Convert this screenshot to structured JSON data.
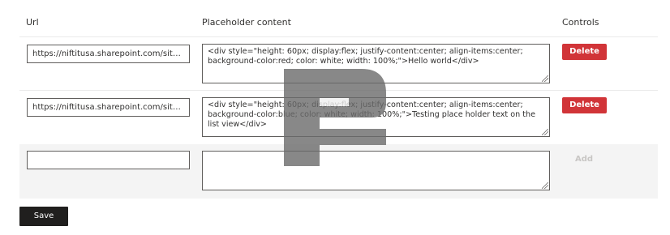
{
  "headers": {
    "url": "Url",
    "placeholder": "Placeholder content",
    "controls": "Controls"
  },
  "rows": [
    {
      "url": "https://niftitusa.sharepoint.com/sites/...",
      "placeholder": "<div style=\"height: 60px; display:flex; justify-content:center; align-items:center; background-color:red; color: white; width: 100%;\">Hello world</div>",
      "delete_label": "Delete"
    },
    {
      "url": "https://niftitusa.sharepoint.com/sites/...",
      "placeholder": "<div style=\"height: 60px; display:flex; justify-content:center; align-items:center; background-color:blue; color: white; width: 100%;\">Testing place holder text on the list view</div>",
      "delete_label": "Delete"
    }
  ],
  "new_row": {
    "url": "",
    "placeholder": "",
    "add_label": "Add"
  },
  "save_label": "Save",
  "colors": {
    "delete": "#d13438",
    "save": "#201f1e",
    "new_row_bg": "#f4f4f4",
    "watermark": "#6b6b6b"
  },
  "icons": {
    "watermark": "logo-watermark-icon",
    "resize": "resize-grip-icon"
  }
}
